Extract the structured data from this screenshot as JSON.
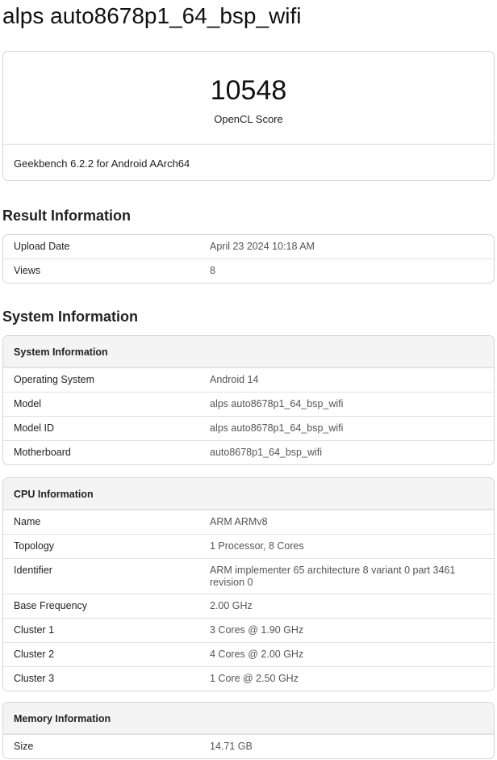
{
  "page_title": "alps auto8678p1_64_bsp_wifi",
  "score": {
    "value": "10548",
    "label": "OpenCL Score",
    "footer": "Geekbench 6.2.2 for Android AArch64"
  },
  "result_section": {
    "title": "Result Information",
    "rows": [
      {
        "label": "Upload Date",
        "value": "April 23 2024 10:18 AM"
      },
      {
        "label": "Views",
        "value": "8"
      }
    ]
  },
  "system_section": {
    "title": "System Information",
    "system_card": {
      "header": "System Information",
      "rows": [
        {
          "label": "Operating System",
          "value": "Android 14"
        },
        {
          "label": "Model",
          "value": "alps auto8678p1_64_bsp_wifi"
        },
        {
          "label": "Model ID",
          "value": "alps auto8678p1_64_bsp_wifi"
        },
        {
          "label": "Motherboard",
          "value": "auto8678p1_64_bsp_wifi"
        }
      ]
    },
    "cpu_card": {
      "header": "CPU Information",
      "rows": [
        {
          "label": "Name",
          "value": "ARM ARMv8"
        },
        {
          "label": "Topology",
          "value": "1 Processor, 8 Cores"
        },
        {
          "label": "Identifier",
          "value": "ARM implementer 65 architecture 8 variant 0 part 3461 revision 0"
        },
        {
          "label": "Base Frequency",
          "value": "2.00 GHz"
        },
        {
          "label": "Cluster 1",
          "value": "3 Cores @ 1.90 GHz"
        },
        {
          "label": "Cluster 2",
          "value": "4 Cores @ 2.00 GHz"
        },
        {
          "label": "Cluster 3",
          "value": "1 Core @ 2.50 GHz"
        }
      ]
    },
    "memory_card": {
      "header": "Memory Information",
      "rows": [
        {
          "label": "Size",
          "value": "14.71 GB"
        }
      ]
    }
  }
}
